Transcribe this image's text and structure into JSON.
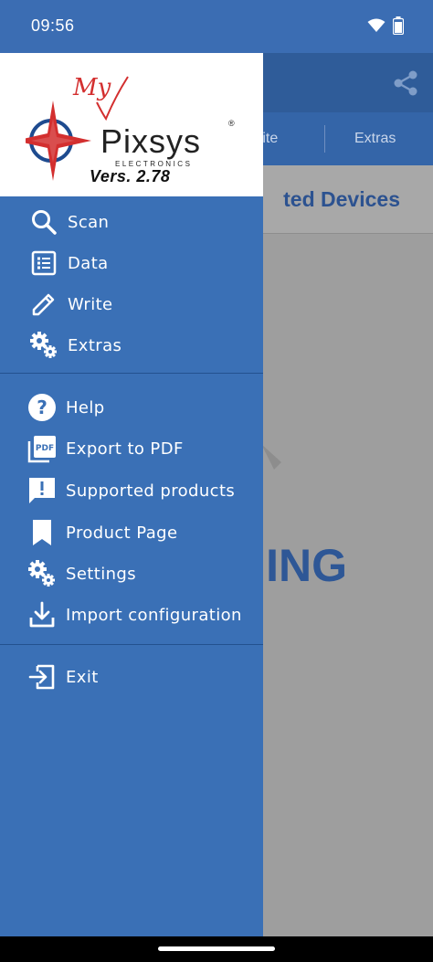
{
  "status_bar": {
    "time": "09:56"
  },
  "app_behind": {
    "tab_write": "rite",
    "tab_extras": "Extras",
    "header_text": "ted Devices",
    "body_text": "ING"
  },
  "drawer": {
    "logo_text": {
      "my": "My",
      "brand": "Pixsys",
      "sub": "ELECTRONICS"
    },
    "version": "Vers. 2.78",
    "primary_items": [
      {
        "label": "Scan",
        "icon": "search-icon"
      },
      {
        "label": "Data",
        "icon": "list-icon"
      },
      {
        "label": "Write",
        "icon": "pencil-icon"
      },
      {
        "label": "Extras",
        "icon": "gears-icon"
      }
    ],
    "secondary_items": [
      {
        "label": "Help",
        "icon": "help-icon"
      },
      {
        "label": "Export to PDF",
        "icon": "pdf-icon"
      },
      {
        "label": "Supported products",
        "icon": "alert-message-icon"
      },
      {
        "label": "Product Page",
        "icon": "bookmark-icon"
      },
      {
        "label": "Settings",
        "icon": "gears-icon"
      },
      {
        "label": "Import configuration",
        "icon": "download-icon"
      }
    ],
    "exit_item": {
      "label": "Exit",
      "icon": "exit-icon"
    }
  },
  "colors": {
    "drawer_bg": "#3a70b6",
    "status_bar": "#3b6db3",
    "logo_red": "#d32f2f",
    "logo_blue": "#1e4b8f"
  }
}
